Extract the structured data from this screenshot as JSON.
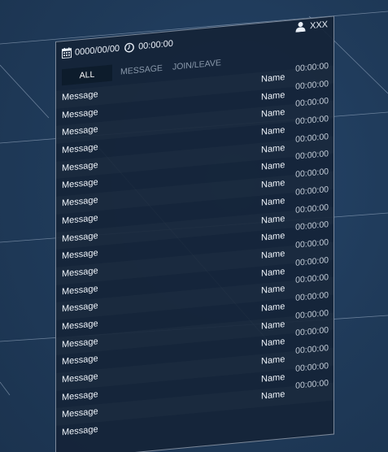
{
  "header": {
    "date": "0000/00/00",
    "time": "00:00:00",
    "username": "XXX"
  },
  "tabs": [
    {
      "label": "ALL",
      "active": true
    },
    {
      "label": "MESSAGE",
      "active": false
    },
    {
      "label": "JOIN/LEAVE",
      "active": false
    }
  ],
  "rows": [
    {
      "message": "Message",
      "name": "Name",
      "time": "00:00:00"
    },
    {
      "message": "Message",
      "name": "Name",
      "time": "00:00:00"
    },
    {
      "message": "Message",
      "name": "Name",
      "time": "00:00:00"
    },
    {
      "message": "Message",
      "name": "Name",
      "time": "00:00:00"
    },
    {
      "message": "Message",
      "name": "Name",
      "time": "00:00:00"
    },
    {
      "message": "Message",
      "name": "Name",
      "time": "00:00:00"
    },
    {
      "message": "Message",
      "name": "Name",
      "time": "00:00:00"
    },
    {
      "message": "Message",
      "name": "Name",
      "time": "00:00:00"
    },
    {
      "message": "Message",
      "name": "Name",
      "time": "00:00:00"
    },
    {
      "message": "Message",
      "name": "Name",
      "time": "00:00:00"
    },
    {
      "message": "Message",
      "name": "Name",
      "time": "00:00:00"
    },
    {
      "message": "Message",
      "name": "Name",
      "time": "00:00:00"
    },
    {
      "message": "Message",
      "name": "Name",
      "time": "00:00:00"
    },
    {
      "message": "Message",
      "name": "Name",
      "time": "00:00:00"
    },
    {
      "message": "Message",
      "name": "Name",
      "time": "00:00:00"
    },
    {
      "message": "Message",
      "name": "Name",
      "time": "00:00:00"
    },
    {
      "message": "Message",
      "name": "Name",
      "time": "00:00:00"
    },
    {
      "message": "Message",
      "name": "Name",
      "time": "00:00:00"
    },
    {
      "message": "Message",
      "name": "Name",
      "time": "00:00:00"
    },
    {
      "message": "Message",
      "name": "",
      "time": ""
    }
  ],
  "icons": {
    "date": "calendar-icon",
    "time": "clock-icon",
    "user": "user-icon"
  },
  "colors": {
    "background": "#1f3a59",
    "panel": "#142438",
    "active_tab": "#0d1c2c",
    "inactive_tab_text": "#8a99ab",
    "text": "#eef3f9"
  }
}
